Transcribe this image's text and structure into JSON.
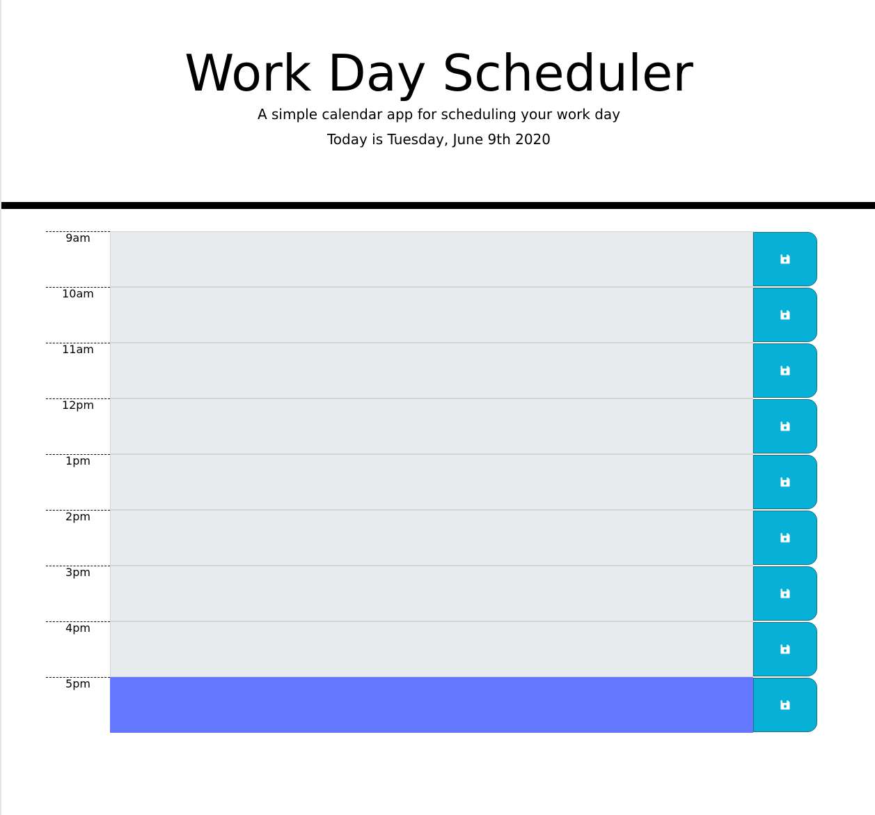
{
  "header": {
    "title": "Work Day Scheduler",
    "subtitle": "A simple calendar app for scheduling your work day",
    "current_day": "Today is Tuesday, June 9th 2020"
  },
  "colors": {
    "past_or_future_block": "#e8ebee",
    "present_block": "#6478ff",
    "save_button": "#06b0d6"
  },
  "schedule": [
    {
      "hour": "9am",
      "text": "",
      "state": "future"
    },
    {
      "hour": "10am",
      "text": "",
      "state": "future"
    },
    {
      "hour": "11am",
      "text": "",
      "state": "future"
    },
    {
      "hour": "12pm",
      "text": "",
      "state": "future"
    },
    {
      "hour": "1pm",
      "text": "",
      "state": "future"
    },
    {
      "hour": "2pm",
      "text": "",
      "state": "future"
    },
    {
      "hour": "3pm",
      "text": "",
      "state": "future"
    },
    {
      "hour": "4pm",
      "text": "",
      "state": "future"
    },
    {
      "hour": "5pm",
      "text": "",
      "state": "present"
    }
  ],
  "icons": {
    "save": "floppy-disk-icon"
  }
}
